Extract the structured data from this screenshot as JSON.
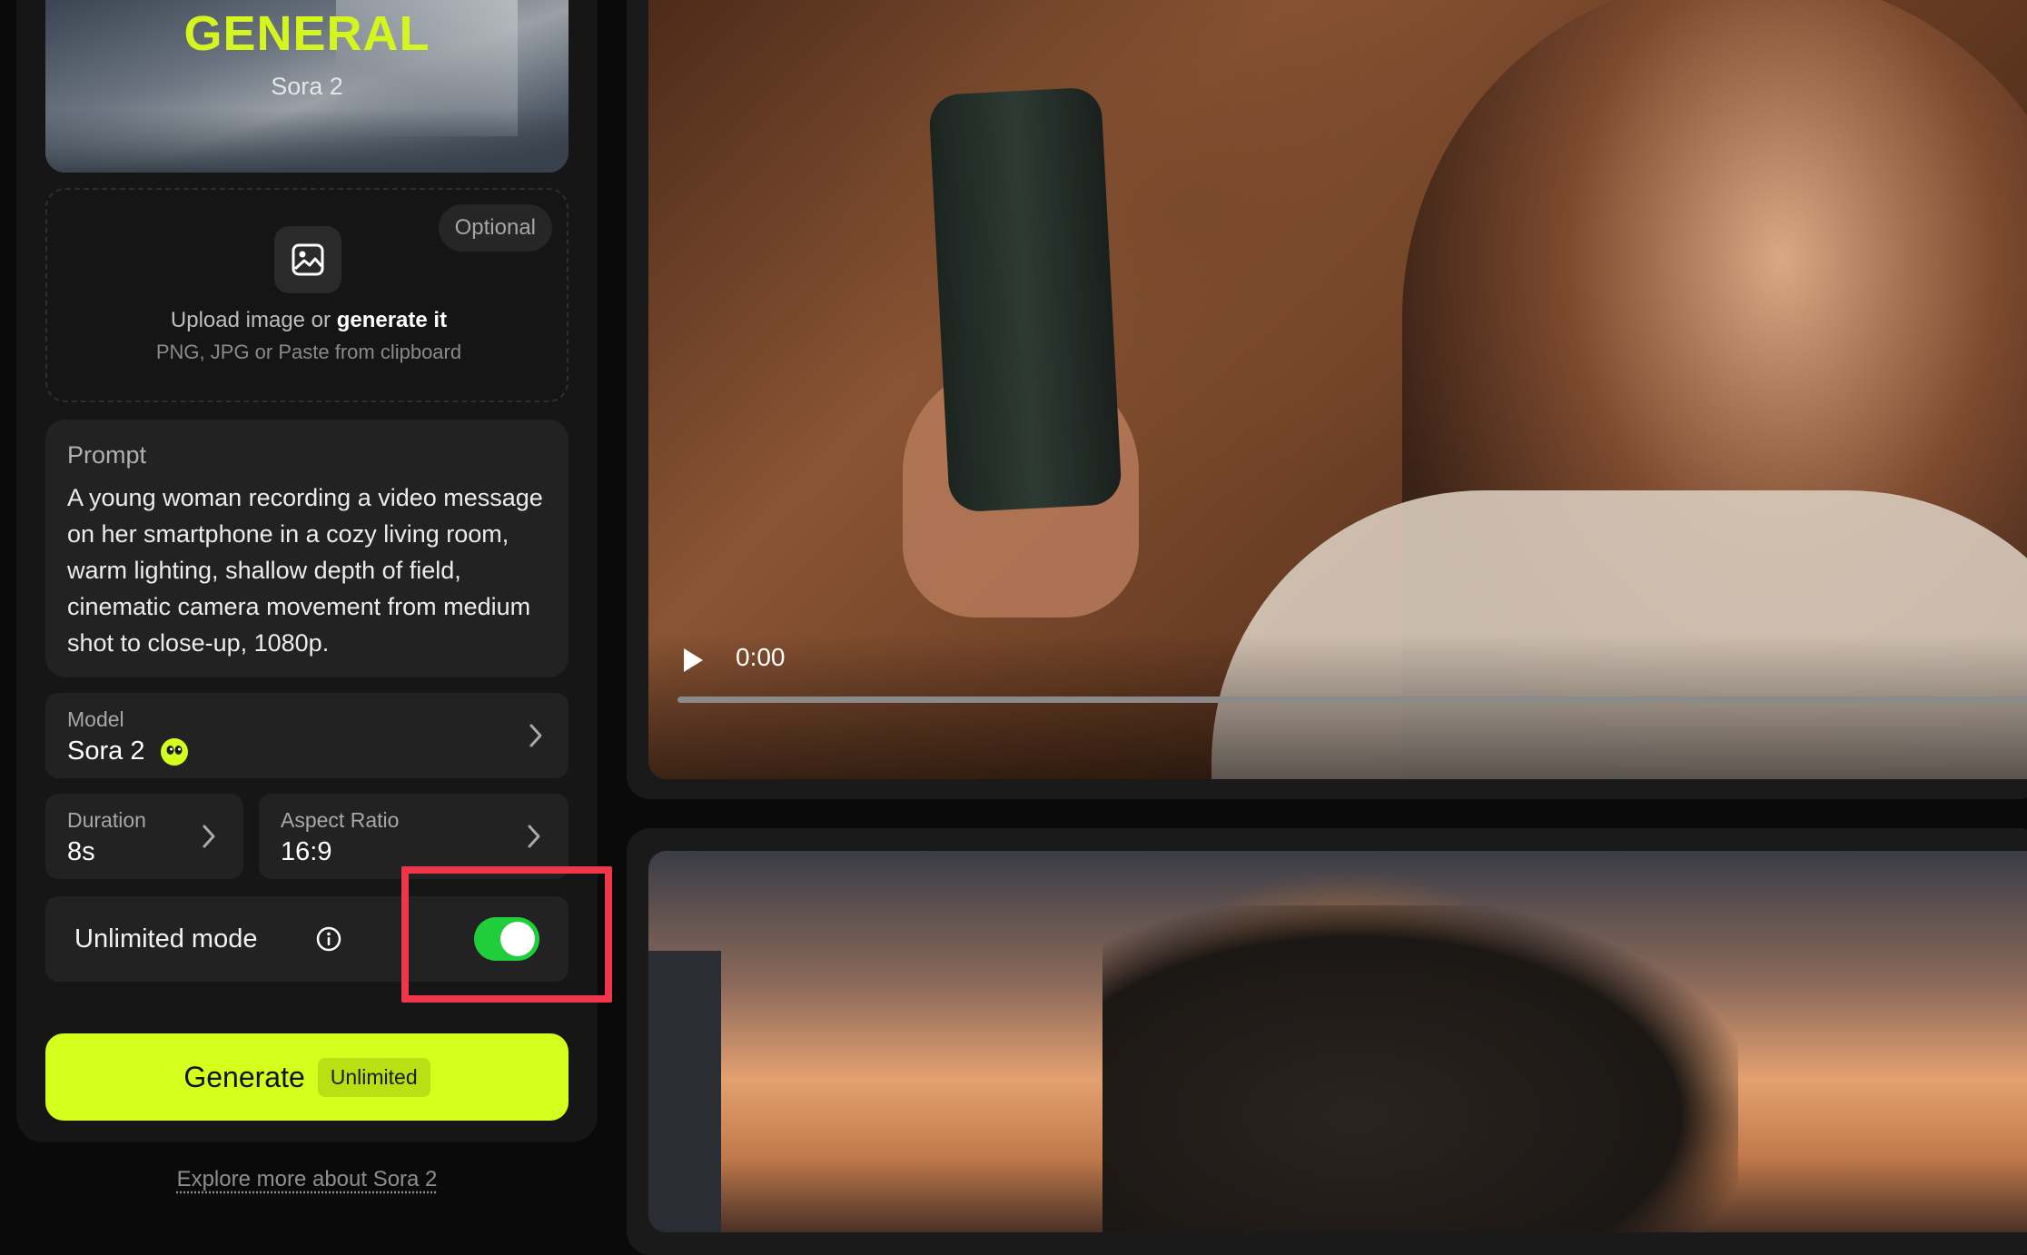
{
  "hero": {
    "title": "GENERAL",
    "subtitle": "Sora 2"
  },
  "upload": {
    "optional_label": "Optional",
    "line1_prefix": "Upload image or",
    "line1_action": "generate it",
    "line2": "PNG, JPG or Paste from clipboard",
    "icon": "image-upload-icon"
  },
  "prompt": {
    "label": "Prompt",
    "text": "A young woman recording a video message on her smartphone in a cozy living room, warm lighting, shallow depth of field, cinematic camera movement from medium shot to close-up, 1080p."
  },
  "model": {
    "label": "Model",
    "value": "Sora 2",
    "badge_icon": "model-badge-icon"
  },
  "duration": {
    "label": "Duration",
    "value": "8s"
  },
  "aspect_ratio": {
    "label": "Aspect Ratio",
    "value": "16:9"
  },
  "unlimited_mode": {
    "label": "Unlimited mode",
    "enabled": true
  },
  "generate": {
    "label": "Generate",
    "badge": "Unlimited"
  },
  "explore_link": "Explore more about Sora 2",
  "video": {
    "time": "0:00",
    "progress": 0.0
  },
  "colors": {
    "accent": "#d4ff1c",
    "toggle_on": "#1fce3a",
    "highlight": "#f0364a",
    "panel": "#161616",
    "card": "#222222"
  }
}
